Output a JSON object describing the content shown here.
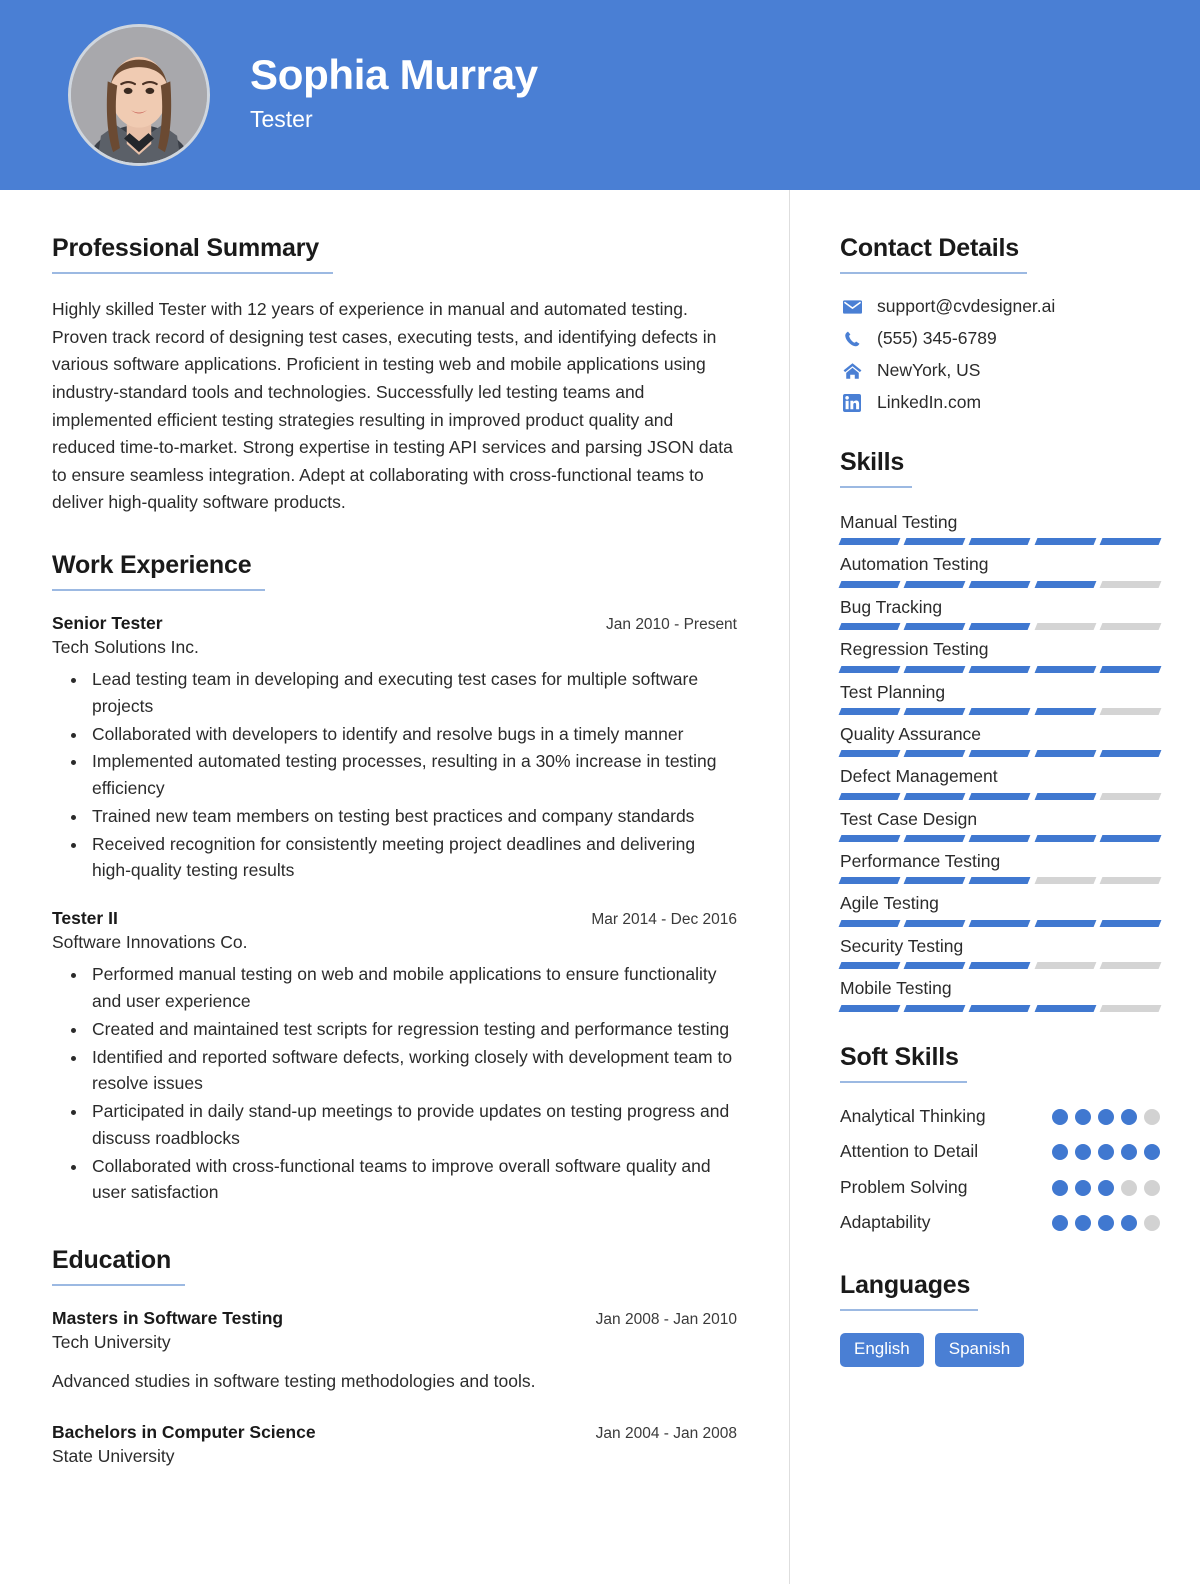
{
  "colors": {
    "accent": "#4a7fd4",
    "bar_on": "#4078d0",
    "bar_off": "#d4d4d4",
    "underline": "#9cb9e2",
    "text": "#2b2b2b"
  },
  "header": {
    "name": "Sophia Murray",
    "role": "Tester",
    "avatar_alt": "profile-photo"
  },
  "main": {
    "summary": {
      "heading": "Professional Summary",
      "text": "Highly skilled Tester with 12 years of experience in manual and automated testing. Proven track record of designing test cases, executing tests, and identifying defects in various software applications. Proficient in testing web and mobile applications using industry-standard tools and technologies. Successfully led testing teams and implemented efficient testing strategies resulting in improved product quality and reduced time-to-market. Strong expertise in testing API services and parsing JSON data to ensure seamless integration. Adept at collaborating with cross-functional teams to deliver high-quality software products."
    },
    "experience": {
      "heading": "Work Experience",
      "items": [
        {
          "title": "Senior Tester",
          "date": "Jan 2010 - Present",
          "company": "Tech Solutions Inc.",
          "bullets": [
            "Lead testing team in developing and executing test cases for multiple software projects",
            "Collaborated with developers to identify and resolve bugs in a timely manner",
            "Implemented automated testing processes, resulting in a 30% increase in testing efficiency",
            "Trained new team members on testing best practices and company standards",
            "Received recognition for consistently meeting project deadlines and delivering high-quality testing results"
          ]
        },
        {
          "title": "Tester II",
          "date": "Mar 2014 - Dec 2016",
          "company": "Software Innovations Co.",
          "bullets": [
            "Performed manual testing on web and mobile applications to ensure functionality and user experience",
            "Created and maintained test scripts for regression testing and performance testing",
            "Identified and reported software defects, working closely with development team to resolve issues",
            "Participated in daily stand-up meetings to provide updates on testing progress and discuss roadblocks",
            "Collaborated with cross-functional teams to improve overall software quality and user satisfaction"
          ]
        }
      ]
    },
    "education": {
      "heading": "Education",
      "items": [
        {
          "degree": "Masters in Software Testing",
          "date": "Jan 2008 - Jan 2010",
          "school": "Tech University",
          "description": "Advanced studies in software testing methodologies and tools."
        },
        {
          "degree": "Bachelors in Computer Science",
          "date": "Jan 2004 - Jan 2008",
          "school": "State University",
          "description": ""
        }
      ]
    }
  },
  "sidebar": {
    "contact": {
      "heading": "Contact Details",
      "items": [
        {
          "icon": "envelope-icon",
          "value": "support@cvdesigner.ai"
        },
        {
          "icon": "phone-icon",
          "value": "(555) 345-6789"
        },
        {
          "icon": "home-icon",
          "value": "NewYork, US"
        },
        {
          "icon": "linkedin-icon",
          "value": "LinkedIn.com"
        }
      ]
    },
    "skills": {
      "heading": "Skills",
      "max": 5,
      "items": [
        {
          "name": "Manual Testing",
          "level": 5
        },
        {
          "name": "Automation Testing",
          "level": 4
        },
        {
          "name": "Bug Tracking",
          "level": 3
        },
        {
          "name": "Regression Testing",
          "level": 5
        },
        {
          "name": "Test Planning",
          "level": 4
        },
        {
          "name": "Quality Assurance",
          "level": 5
        },
        {
          "name": "Defect Management",
          "level": 4
        },
        {
          "name": "Test Case Design",
          "level": 5
        },
        {
          "name": "Performance Testing",
          "level": 3
        },
        {
          "name": "Agile Testing",
          "level": 5
        },
        {
          "name": "Security Testing",
          "level": 3
        },
        {
          "name": "Mobile Testing",
          "level": 4
        }
      ]
    },
    "soft_skills": {
      "heading": "Soft Skills",
      "max": 5,
      "items": [
        {
          "name": "Analytical Thinking",
          "level": 4
        },
        {
          "name": "Attention to Detail",
          "level": 5
        },
        {
          "name": "Problem Solving",
          "level": 3
        },
        {
          "name": "Adaptability",
          "level": 4
        }
      ]
    },
    "languages": {
      "heading": "Languages",
      "items": [
        "English",
        "Spanish"
      ]
    }
  }
}
